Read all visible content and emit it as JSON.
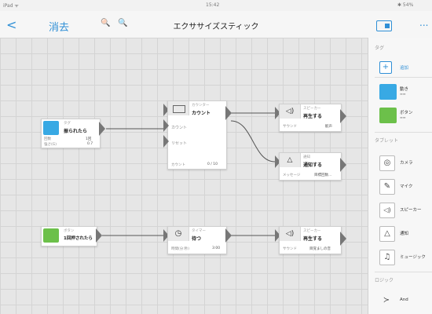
{
  "status": {
    "carrier": "iPad ᯤ",
    "time": "15:42",
    "battery": "✱ 54%"
  },
  "navbar": {
    "back": "<",
    "delete": "消去",
    "zoom_out": "🔍",
    "zoom_in": "🔍",
    "title": "エクササイズスティック",
    "more": "..."
  },
  "nodes": {
    "shake": {
      "type": "タグ",
      "name": "振られたら",
      "rows": [
        {
          "label": "回数",
          "value": "1回"
        },
        {
          "label": "強さ(G)",
          "value": "0.7"
        }
      ],
      "icon_color": "#38a9e4"
    },
    "counter": {
      "type": "カウンター",
      "name": "カウント",
      "labels": [
        "カウント",
        "リセット"
      ],
      "footer_label": "カウント",
      "footer_value": "0 / 10"
    },
    "speaker1": {
      "type": "スピーカー",
      "name": "再生する",
      "footer_label": "サウンド",
      "footer_value": "歓声"
    },
    "notify": {
      "type": "通知",
      "name": "通知する",
      "footer_label": "メッセージ",
      "footer_value": "目標回数..."
    },
    "button": {
      "type": "ボタン",
      "name": "1回押されたら",
      "icon_color": "#6cc04a"
    },
    "timer": {
      "type": "タイマー",
      "name": "待つ",
      "footer_label": "時間(分:秒)",
      "footer_value": "3:00"
    },
    "speaker2": {
      "type": "スピーカー",
      "name": "再生する",
      "footer_label": "サウンド",
      "footer_value": "目覚ましの音"
    }
  },
  "sidebar": {
    "tag_section": "タグ",
    "add_label": "追加",
    "tags": [
      {
        "name": "動き",
        "sub": "▬▬",
        "color": "#38a9e4"
      },
      {
        "name": "ボタン",
        "sub": "▬▬",
        "color": "#6cc04a"
      }
    ],
    "tablet_section": "タブレット",
    "tablet_items": [
      {
        "label": "カメラ",
        "icon": "camera-icon",
        "glyph": "◎"
      },
      {
        "label": "マイク",
        "icon": "microphone-icon",
        "glyph": "✎"
      },
      {
        "label": "スピーカー",
        "icon": "speaker-icon",
        "glyph": "◁)"
      },
      {
        "label": "通知",
        "icon": "bell-icon",
        "glyph": "△"
      },
      {
        "label": "ミュージック",
        "icon": "music-icon",
        "glyph": "♫"
      }
    ],
    "logic_section": "ロジック",
    "logic_items": [
      {
        "label": "And",
        "icon": "and-gate-icon",
        "glyph": "≻"
      }
    ]
  }
}
